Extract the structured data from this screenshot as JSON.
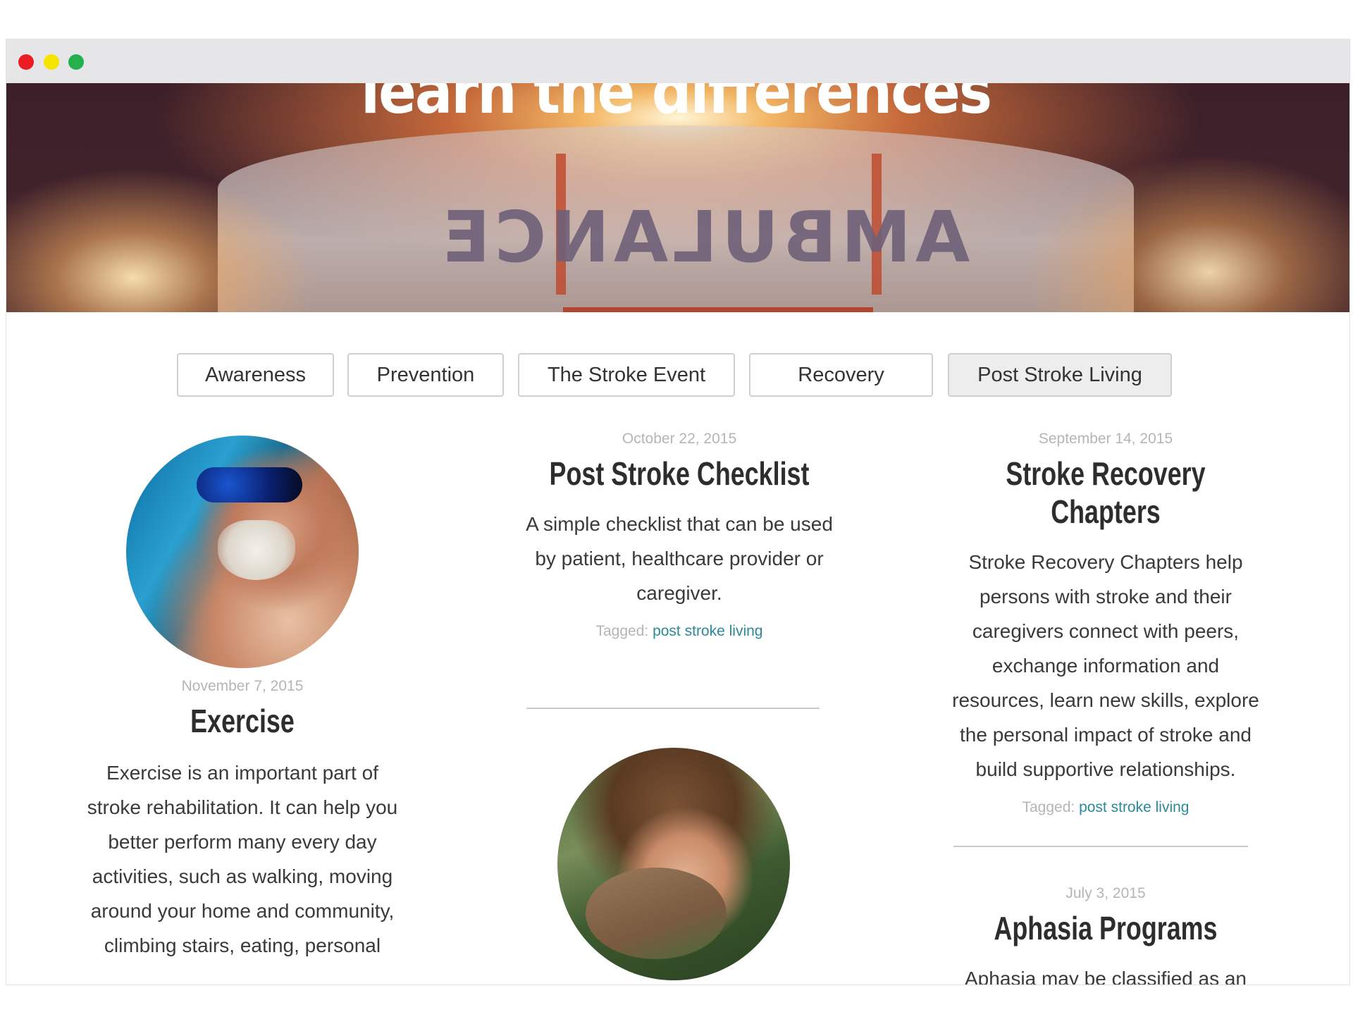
{
  "window": {
    "controls": [
      "close",
      "minimize",
      "maximize"
    ],
    "colors": {
      "close": "#ec1c24",
      "minimize": "#f5e400",
      "maximize": "#23b14d"
    }
  },
  "hero": {
    "headline": "learn the differences",
    "vehicle_text": "AMBULANCE"
  },
  "tabs": [
    {
      "label": "Awareness",
      "active": false
    },
    {
      "label": "Prevention",
      "active": false
    },
    {
      "label": "The Stroke Event",
      "active": false
    },
    {
      "label": "Recovery",
      "active": false
    },
    {
      "label": "Post Stroke Living",
      "active": true
    }
  ],
  "articles": {
    "exercise": {
      "date": "November 7, 2015",
      "title": "Exercise",
      "excerpt_lines": [
        "Exercise is an important part of",
        "stroke rehabilitation. It can help you",
        "better perform many every day",
        "activities, such as walking, moving",
        "around your home and community,",
        "climbing stairs, eating, personal"
      ]
    },
    "checklist": {
      "date": "October 22, 2015",
      "title": "Post Stroke Checklist",
      "excerpt_lines": [
        "A simple checklist that can be used",
        "by patient, healthcare provider or",
        "caregiver."
      ],
      "tagged_label": "Tagged:",
      "tag": "post stroke living"
    },
    "chapters": {
      "date": "September 14, 2015",
      "title": "Stroke Recovery Chapters",
      "excerpt_lines": [
        "Stroke Recovery Chapters help",
        "persons with stroke and their",
        "caregivers connect with peers,",
        "exchange information and",
        "resources, learn new skills, explore",
        "the personal impact of stroke and",
        "build supportive relationships."
      ],
      "tagged_label": "Tagged:",
      "tag": "post stroke living"
    },
    "aphasia": {
      "date": "July 3, 2015",
      "title": "Aphasia Programs",
      "excerpt_partial": "Aphasia may be classified as an"
    }
  },
  "colors": {
    "tag_link": "#2a8a9a",
    "date_text": "#b5b5b5",
    "active_tab_bg": "#ededed"
  }
}
